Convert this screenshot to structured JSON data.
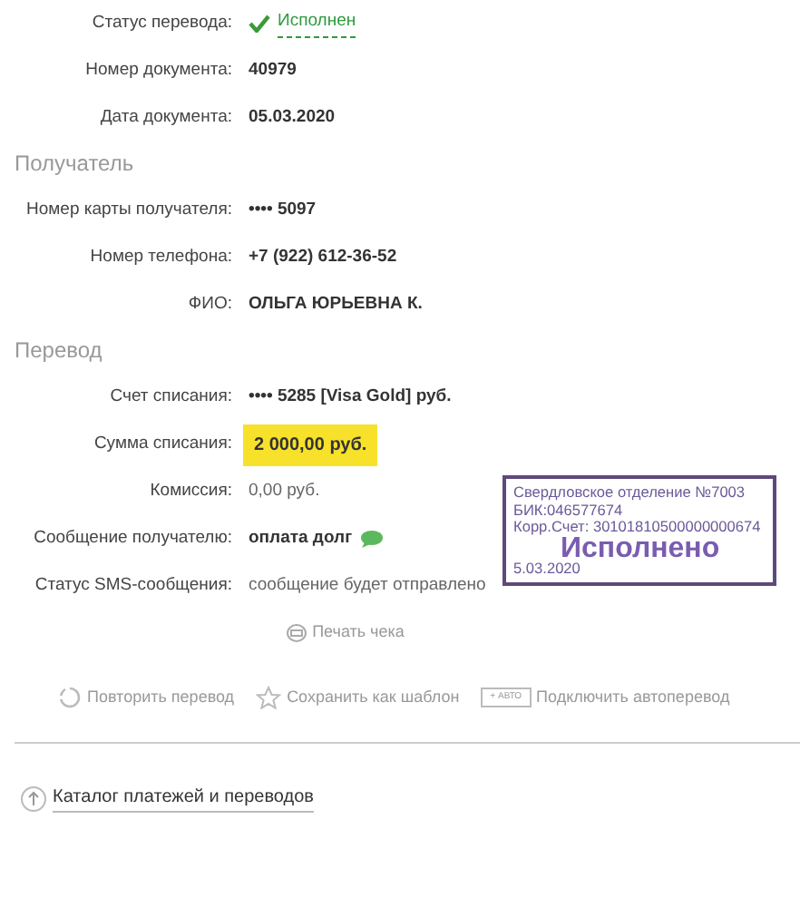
{
  "sections": [
    {
      "rows": [
        {
          "label": "Статус перевода:",
          "value": "Исполнен",
          "kind": "status"
        },
        {
          "label": "Номер документа:",
          "value": "40979",
          "kind": "bold"
        },
        {
          "label": "Дата документа:",
          "value": "05.03.2020",
          "kind": "bold"
        }
      ]
    },
    {
      "heading": "Получатель",
      "rows": [
        {
          "label": "Номер карты получателя:",
          "value": "•••• 5097",
          "kind": "bold"
        },
        {
          "label": "Номер телефона:",
          "value": "+7 (922) 612-36-52",
          "kind": "bold"
        },
        {
          "label": "ФИО:",
          "value": "ОЛЬГА ЮРЬЕВНА К.",
          "kind": "bold"
        }
      ]
    },
    {
      "heading": "Перевод",
      "rows": [
        {
          "label": "Счет списания:",
          "value": "•••• 5285  [Visa Gold]  руб.",
          "kind": "bold"
        },
        {
          "label": "Сумма списания:",
          "value": "2 000,00  руб.",
          "kind": "highlight"
        },
        {
          "label": "Комиссия:",
          "value": "0,00 руб.",
          "kind": "plain"
        },
        {
          "label": "Сообщение получателю:",
          "value": "оплата долг",
          "kind": "message"
        },
        {
          "label": "Статус SMS-сообщения:",
          "value": "сообщение будет отправлено",
          "kind": "plain"
        }
      ]
    }
  ],
  "stamp": {
    "lines": [
      "Свердловское отделение №7003",
      "БИК:046577674",
      "Корр.Счет: 30101810500000000674"
    ],
    "status": "Исполнено",
    "date": "5.03.2020"
  },
  "print_link": "Печать чека",
  "actions": [
    {
      "label": "Повторить перевод",
      "kind": "repeat"
    },
    {
      "label": "Сохранить как шаблон",
      "kind": "template"
    },
    {
      "label": "Подключить автоперевод",
      "kind": "auto",
      "badge": "+ АВТО"
    }
  ],
  "catalog_link": "Каталог платежей и переводов"
}
